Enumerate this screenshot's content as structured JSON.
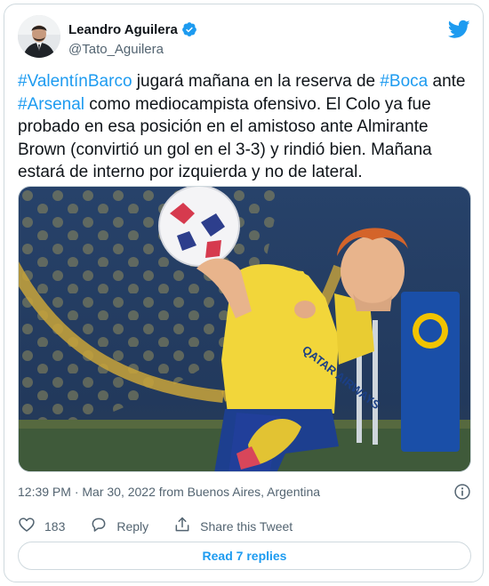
{
  "author": {
    "name": "Leandro Aguilera",
    "handle": "@Tato_Aguilera"
  },
  "tweet": {
    "segments": [
      {
        "text": "#ValentínBarco",
        "hashtag": true
      },
      {
        "text": " jugará mañana en la reserva de ",
        "hashtag": false
      },
      {
        "text": "#Boca",
        "hashtag": true
      },
      {
        "text": " ante ",
        "hashtag": false
      },
      {
        "text": "#Arsenal",
        "hashtag": true
      },
      {
        "text": " como mediocampista ofensivo. El Colo ya fue probado en esa posición en el amistoso ante Almirante Brown (convirtió un gol en el 3-3) y rindió bien. Mañana estará de interno por izquierda y no de lateral.",
        "hashtag": false
      }
    ]
  },
  "media": {
    "shirt_text": "QATAR AIRWAYS"
  },
  "meta": {
    "timestamp": "12:39 PM · Mar 30, 2022 from Buenos Aires, Argentina"
  },
  "actions": {
    "likes": "183",
    "reply_label": "Reply",
    "share_label": "Share this Tweet"
  },
  "replies_button": "Read 7 replies",
  "colors": {
    "accent": "#1d9bf0",
    "text": "#0f1419",
    "secondary": "#536471",
    "border": "#cfd9de"
  },
  "icons": [
    "verified-badge-icon",
    "twitter-bird-icon",
    "info-icon",
    "heart-icon",
    "reply-icon",
    "share-icon"
  ]
}
